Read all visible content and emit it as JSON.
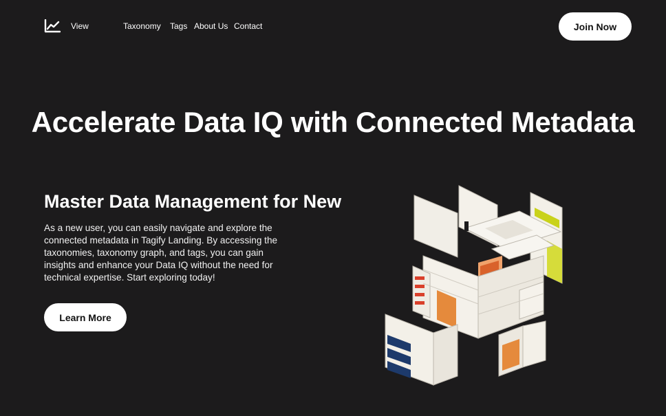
{
  "nav": {
    "logo_icon": "line-chart-icon",
    "links": [
      {
        "label": "View"
      },
      {
        "label": "Taxonomy"
      },
      {
        "label": "Tags"
      },
      {
        "label": "About Us"
      },
      {
        "label": "Contact"
      }
    ],
    "cta_label": "Join Now"
  },
  "hero": {
    "title": "Accelerate Data IQ with Connected Metadata"
  },
  "section": {
    "heading": "Master Data Management for New",
    "body": "As a new user, you can easily navigate and explore the connected metadata in Tagify Landing. By accessing the taxonomies, taxonomy graph, and tags, you can gain insights and enhance your Data IQ without the need for technical expertise. Start exploring today!",
    "button_label": "Learn More",
    "illustration_icon": "isometric-data-blocks-illustration"
  },
  "colors": {
    "background": "#1c1b1c",
    "text": "#ffffff",
    "button_bg": "#ffffff",
    "button_text": "#111111",
    "accent_red": "#d9402b",
    "accent_yellow": "#c9d21a",
    "accent_navy": "#1d3a6b",
    "accent_orange": "#e58a3c"
  }
}
